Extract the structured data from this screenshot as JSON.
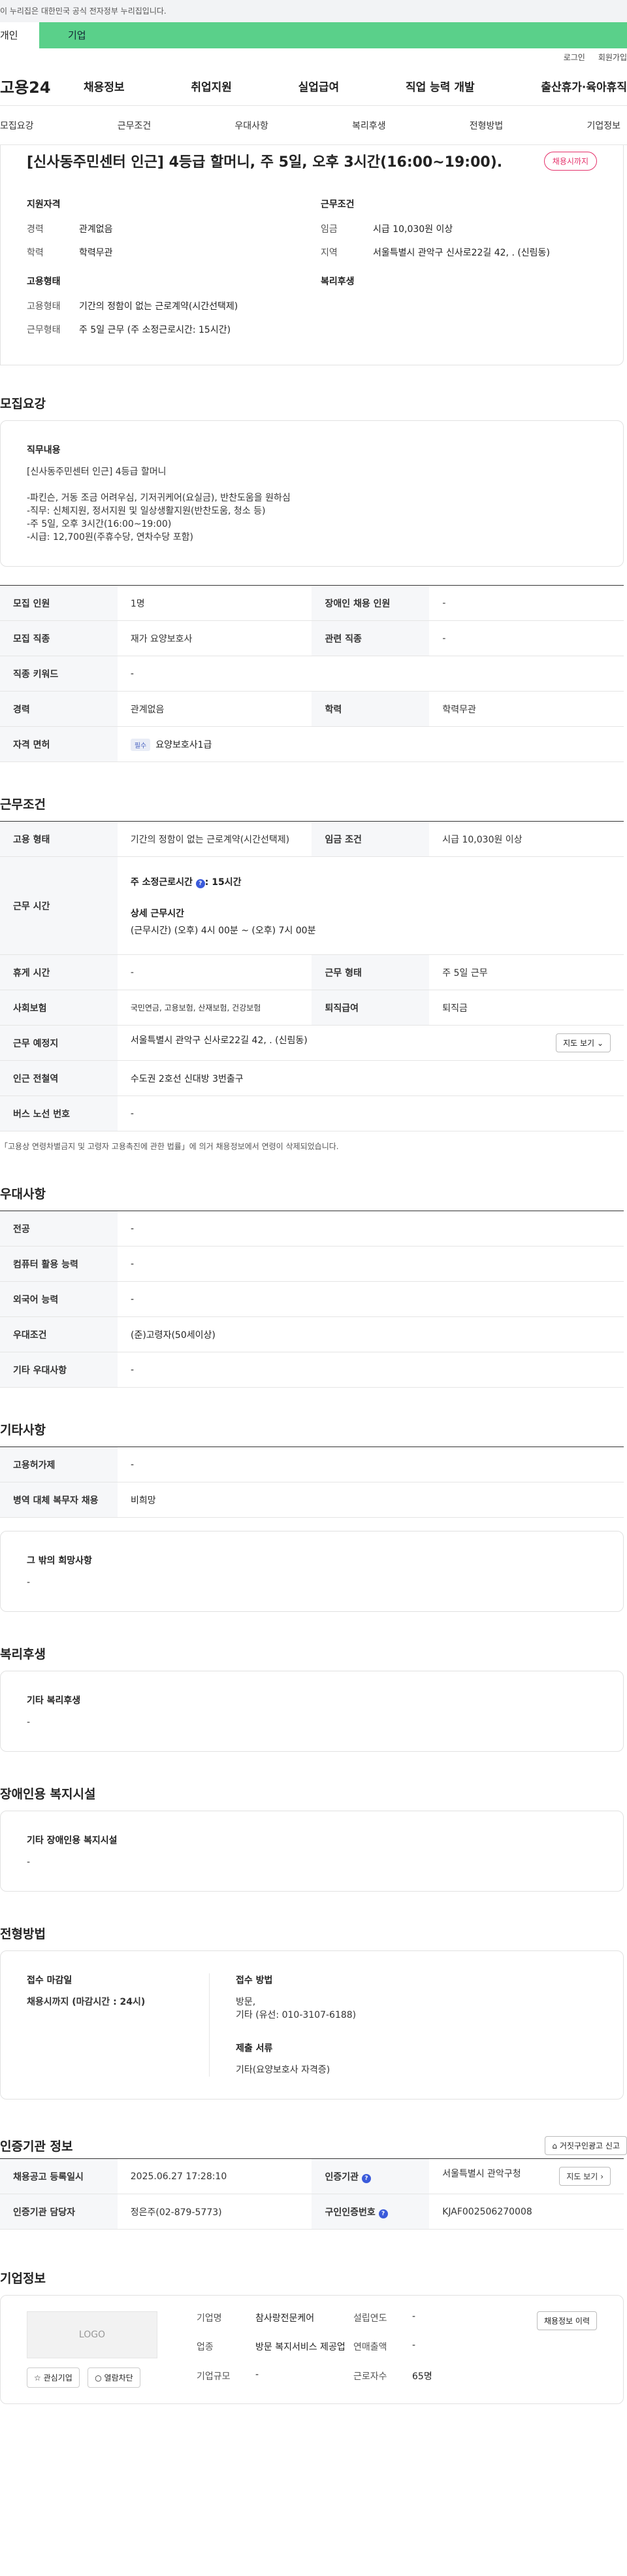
{
  "gov_bar": "이 누리집은 대한민국 공식 전자정부 누리집입니다.",
  "tabs": [
    "개인",
    "기업"
  ],
  "util": [
    "로그인",
    "회원가입"
  ],
  "logo": "고용24",
  "gnb": [
    "채용정보",
    "취업지원",
    "실업급여",
    "직업 능력 개발",
    "출산휴가·육아휴직"
  ],
  "subnav": [
    "모집요강",
    "근무조건",
    "우대사항",
    "복리후생",
    "전형방법",
    "기업정보"
  ],
  "job_title": "[신사동주민센터 인근] 4등급 할머니, 주 5일, 오후 3시간(16:00~19:00).",
  "status": "채용시까지",
  "summary": {
    "left_h1": "지원자격",
    "left_rows": [
      [
        "경력",
        "관계없음"
      ],
      [
        "학력",
        "학력무관"
      ]
    ],
    "left_h2": "고용형태",
    "left_rows2": [
      [
        "고용형태",
        "기간의 정함이 없는 근로계약(시간선택제)"
      ],
      [
        "근무형태",
        "주 5일 근무 (주 소정근로시간: 15시간)"
      ]
    ],
    "right_h1": "근무조건",
    "right_rows": [
      [
        "임금",
        "시급 10,030원 이상"
      ],
      [
        "지역",
        "서울특별시 관악구 신사로22길 42, . (신림동)"
      ]
    ],
    "right_h2": "복리후생"
  },
  "recruit": {
    "title": "모집요강",
    "box_h": "직무내용",
    "lines": [
      "[신사동주민센터 인근] 4등급 할머니",
      "",
      "-파킨슨, 거동 조금 어려우심, 기저귀케어(요실금), 반찬도움을 원하심",
      "-직무: 신체지원, 정서지원 및 일상생활지원(반찬도움, 청소 등)",
      "-주 5일, 오후 3시간(16:00~19:00)",
      "-시급: 12,700원(주휴수당, 연차수당 포함)"
    ],
    "rows": [
      [
        "모집 인원",
        "1명",
        "장애인 채용 인원",
        "-"
      ],
      [
        "모집 직종",
        "재가 요양보호사",
        "관련 직종",
        "-"
      ],
      [
        "직종 키워드",
        "-"
      ],
      [
        "경력",
        "관계없음",
        "학력",
        "학력무관"
      ],
      [
        "자격 면허",
        "요양보호사1급"
      ]
    ],
    "license_tag": "필수"
  },
  "work": {
    "title": "근무조건",
    "r1": [
      "고용 형태",
      "기간의 정함이 없는 근로계약(시간선택제)",
      "임금 조건",
      "시급 10,030원 이상"
    ],
    "time_k": "근무 시간",
    "time_week": "주 소정근로시간",
    "time_week_val": ": 15시간",
    "time_detail_h": "상세 근무시간",
    "time_detail": "(근무시간) (오후) 4시 00분 ~ (오후) 7시 00분",
    "r3": [
      "휴게 시간",
      "-",
      "근무 형태",
      "주 5일 근무"
    ],
    "r4": [
      "사회보험",
      "국민연금, 고용보험, 산재보험, 건강보험",
      "퇴직급여",
      "퇴직금"
    ],
    "r5": [
      "근무 예정지",
      "서울특별시 관악구 신사로22길 42, . (신림동)"
    ],
    "map_btn": "지도 보기",
    "r6": [
      "인근 전철역",
      "수도권 2호선 신대방 3번출구"
    ],
    "r7": [
      "버스 노선 번호",
      "-"
    ],
    "note": "「고용상 연령차별금지 및 고령자 고용촉진에 관한 법률」에 의거 채용정보에서 연령이 삭제되었습니다."
  },
  "prefer": {
    "title": "우대사항",
    "rows": [
      [
        "전공",
        "-"
      ],
      [
        "컴퓨터 활용 능력",
        "-"
      ],
      [
        "외국어 능력",
        "-"
      ],
      [
        "우대조건",
        "(준)고령자(50세이상)"
      ],
      [
        "기타 우대사항",
        "-"
      ]
    ]
  },
  "other": {
    "title": "기타사항",
    "rows": [
      [
        "고용허가제",
        "-"
      ],
      [
        "병역 대체 복무자 채용",
        "비희망"
      ]
    ],
    "box_h": "그 밖의 희망사항",
    "box_v": "-"
  },
  "welfare": {
    "title": "복리후생",
    "box_h": "기타 복리후생",
    "box_v": "-"
  },
  "disabled": {
    "title": "장애인용 복지시설",
    "box_h": "기타 장애인용 복지시설",
    "box_v": "-"
  },
  "method": {
    "title": "전형방법",
    "deadline_h": "접수 마감일",
    "deadline_v": "채용시까지 (마감시간 : 24시)",
    "how_h": "접수 방법",
    "how_v1": "방문,",
    "how_v2": "기타 (유선: 010-3107-6188)",
    "docs_h": "제출 서류",
    "docs_v": "기타(요양보호사 자격증)"
  },
  "cert": {
    "title": "인증기관 정보",
    "report_btn": "거짓구인광고 신고",
    "r1": [
      "채용공고 등록일시",
      "2025.06.27 17:28:10",
      "인증기관",
      "서울특별시 관악구청"
    ],
    "r2": [
      "인증기관 담당자",
      "정은주(02-879-5773)",
      "구인인증번호",
      "KJAF002506270008"
    ],
    "map_btn": "지도 보기"
  },
  "company": {
    "title": "기업정보",
    "logo": "LOGO",
    "btn1": "관심기업",
    "btn2": "열람차단",
    "history_btn": "채용정보 이력",
    "info": [
      [
        "기업명",
        "참사랑전문케어"
      ],
      [
        "설립연도",
        "-"
      ],
      [
        "업종",
        "방문 복지서비스 제공업"
      ],
      [
        "연매출액",
        "-"
      ],
      [
        "기업규모",
        "-"
      ],
      [
        "근로자수",
        "65명"
      ]
    ]
  }
}
